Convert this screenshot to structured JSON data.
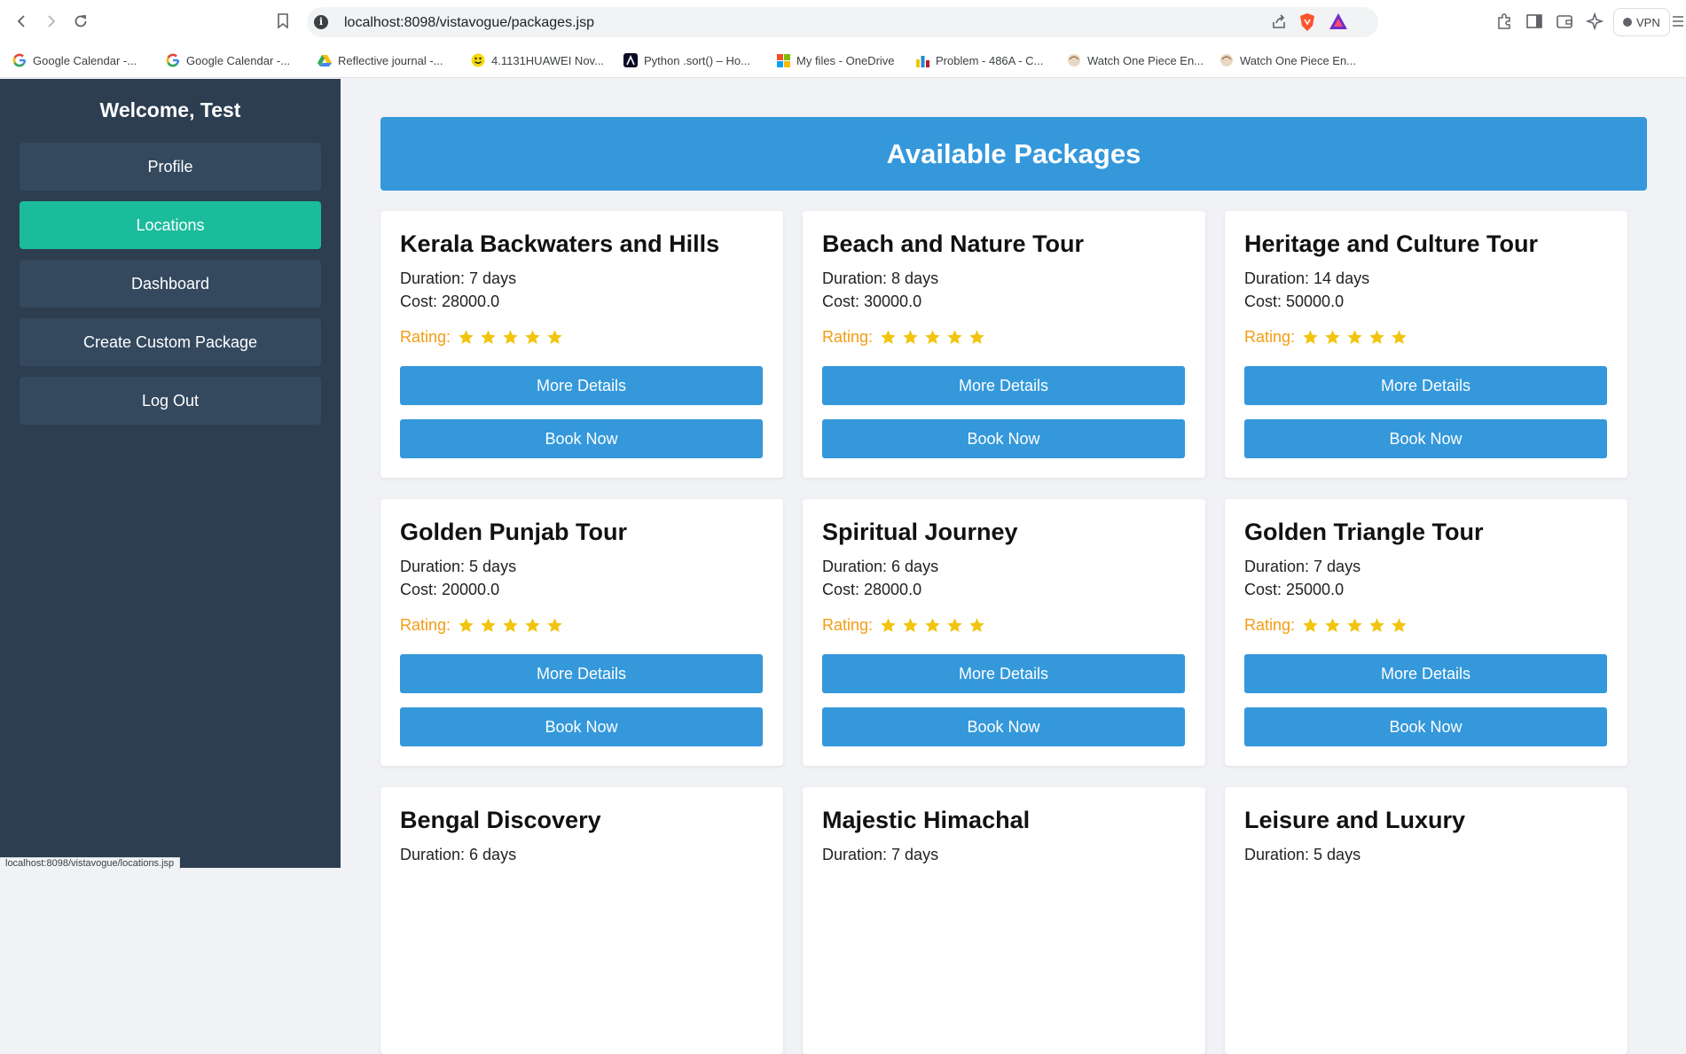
{
  "browser": {
    "url": "localhost:8098/vistavogue/packages.jsp",
    "vpn_label": "VPN",
    "bookmarks": [
      {
        "label": "Google Calendar -...",
        "icon": "google-icon"
      },
      {
        "label": "Google Calendar -...",
        "icon": "google-icon"
      },
      {
        "label": "Reflective journal -...",
        "icon": "drive-icon"
      },
      {
        "label": "4.1131HUAWEI Nov...",
        "icon": "smiley-icon"
      },
      {
        "label": "Python .sort() – Ho...",
        "icon": "site-icon"
      },
      {
        "label": "My files - OneDrive",
        "icon": "microsoft-icon"
      },
      {
        "label": "Problem - 486A - C...",
        "icon": "codeforces-icon"
      },
      {
        "label": "Watch One Piece En...",
        "icon": "anime-icon"
      },
      {
        "label": "Watch One Piece En...",
        "icon": "anime-icon"
      }
    ],
    "status_url": "localhost:8098/vistavogue/locations.jsp"
  },
  "sidebar": {
    "welcome": "Welcome, Test",
    "items": [
      {
        "label": "Profile",
        "active": false
      },
      {
        "label": "Locations",
        "active": true
      },
      {
        "label": "Dashboard",
        "active": false
      },
      {
        "label": "Create Custom Package",
        "active": false
      },
      {
        "label": "Log Out",
        "active": false
      }
    ]
  },
  "main": {
    "header": "Available Packages",
    "rating_label": "Rating:",
    "details_label": "More Details",
    "book_label": "Book Now",
    "packages": [
      {
        "title": "Kerala Backwaters and Hills",
        "duration": "Duration: 7 days",
        "cost": "Cost: 28000.0",
        "stars": 5
      },
      {
        "title": "Beach and Nature Tour",
        "duration": "Duration: 8 days",
        "cost": "Cost: 30000.0",
        "stars": 5
      },
      {
        "title": "Heritage and Culture Tour",
        "duration": "Duration: 14 days",
        "cost": "Cost: 50000.0",
        "stars": 5
      },
      {
        "title": "Golden Punjab Tour",
        "duration": "Duration: 5 days",
        "cost": "Cost: 20000.0",
        "stars": 5
      },
      {
        "title": "Spiritual Journey",
        "duration": "Duration: 6 days",
        "cost": "Cost: 28000.0",
        "stars": 5
      },
      {
        "title": "Golden Triangle Tour",
        "duration": "Duration: 7 days",
        "cost": "Cost: 25000.0",
        "stars": 5
      },
      {
        "title": "Bengal Discovery",
        "duration": "Duration: 6 days",
        "cost": "",
        "stars": 0
      },
      {
        "title": "Majestic Himachal",
        "duration": "Duration: 7 days",
        "cost": "",
        "stars": 0
      },
      {
        "title": "Leisure and Luxury",
        "duration": "Duration: 5 days",
        "cost": "",
        "stars": 0
      }
    ]
  },
  "colors": {
    "sidebar_bg": "#2c3e50",
    "sidebar_item": "#34495e",
    "active_item": "#1abc9c",
    "primary": "#3498db",
    "rating_text": "#f39c12",
    "star": "#f1c40f"
  }
}
